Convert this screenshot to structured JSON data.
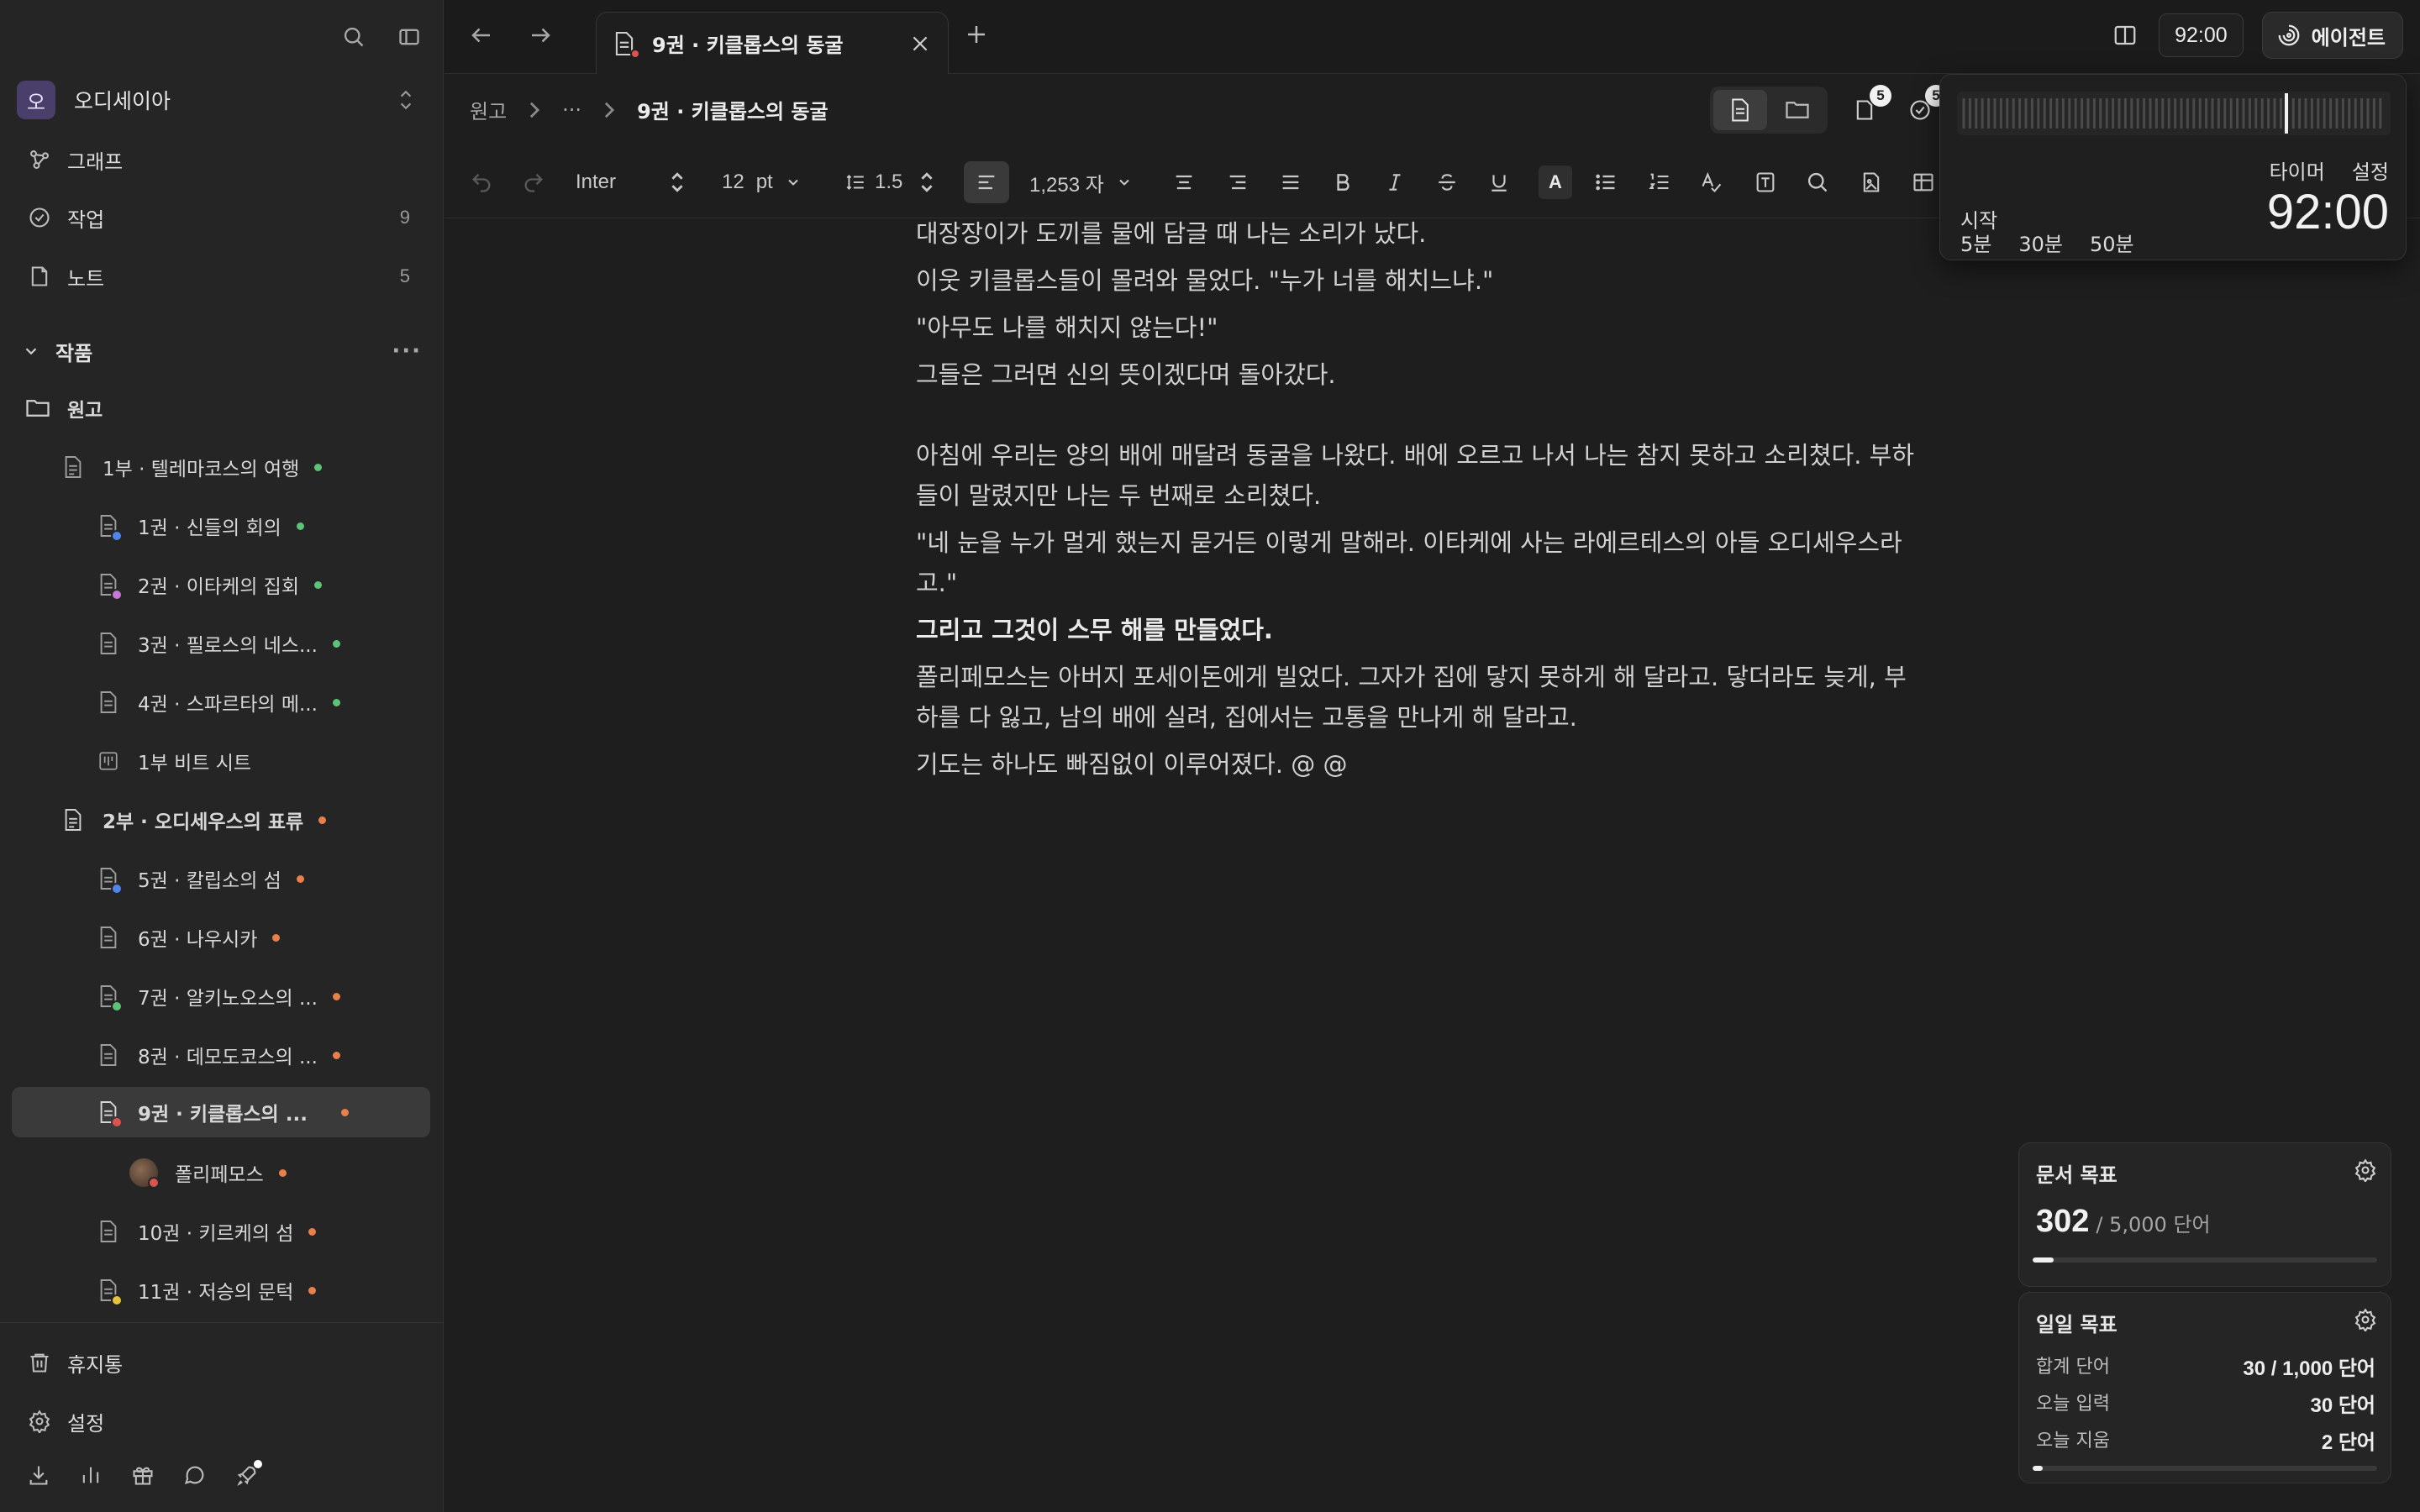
{
  "sidebar": {
    "workspace": {
      "avatar": "오",
      "name": "오디세이아"
    },
    "nav": [
      {
        "label": "그래프",
        "count": ""
      },
      {
        "label": "작업",
        "count": "9"
      },
      {
        "label": "노트",
        "count": "5"
      }
    ],
    "section": {
      "label": "작품",
      "more": "···"
    },
    "tree": [
      {
        "label": "원고"
      },
      {
        "label": "1부 · 텔레마코스의 여행"
      },
      {
        "label": "1권 · 신들의 회의"
      },
      {
        "label": "2권 · 이타케의 집회"
      },
      {
        "label": "3권 · 필로스의 네스..."
      },
      {
        "label": "4권 · 스파르타의 메..."
      },
      {
        "label": "1부 비트 시트"
      },
      {
        "label": "2부 · 오디세우스의 표류"
      },
      {
        "label": "5권 · 칼립소의 섬"
      },
      {
        "label": "6권 · 나우시카"
      },
      {
        "label": "7권 · 알키노오스의 ..."
      },
      {
        "label": "8권 · 데모도코스의 ..."
      },
      {
        "label": "9권 · 키클롭스의 ..."
      },
      {
        "label": "폴리페모스"
      },
      {
        "label": "10권 · 키르케의 섬"
      },
      {
        "label": "11권 · 저승의 문턱"
      }
    ],
    "footer": [
      {
        "label": "휴지통"
      },
      {
        "label": "설정"
      }
    ]
  },
  "tabbar": {
    "tab_title": "9권 · 키클롭스의 동굴",
    "timer": "92:00",
    "agent_label": "에이전트"
  },
  "breadcrumb": {
    "root": "원고",
    "ellipsis": "···",
    "current": "9권 · 키클롭스의 동굴",
    "pages_count": "5",
    "tasks_count": "5"
  },
  "toolbar": {
    "font": "Inter",
    "size": "12",
    "unit": "pt",
    "line_height": "1.5",
    "char_count": "1,253 자",
    "color_label": "A"
  },
  "editor": {
    "paragraphs": [
      "대장장이가 도끼를 물에 담글 때 나는 소리가 났다.",
      "이웃 키클롭스들이 몰려와 물었다. \"누가 너를 해치느냐.\"",
      "\"아무도 나를 해치지 않는다!\"",
      "그들은 그러면 신의 뜻이겠다며 돌아갔다.",
      "아침에 우리는 양의 배에 매달려 동굴을 나왔다. 배에 오르고 나서 나는 참지 못하고 소리쳤다. 부하들이 말렸지만 나는 두 번째로 소리쳤다.",
      "\"네 눈을 누가 멀게 했는지 묻거든 이렇게 말해라. 이타케에 사는 라에르테스의 아들 오디세우스라고.\"",
      "그리고 그것이 스무 해를 만들었다.",
      "폴리페모스는 아버지 포세이돈에게 빌었다. 그자가 집에 닿지 못하게 해 달라고. 닿더라도 늦게, 부하를 다 잃고, 남의 배에 실려, 집에서는 고통을 만나게 해 달라고.",
      "기도는 하나도 빠짐없이 이루어졌다. @ @"
    ]
  },
  "timer_popup": {
    "presets": [
      "5분",
      "30분",
      "50분"
    ],
    "timer_link": "타이머",
    "settings_link": "설정",
    "start_label": "시작",
    "time": "92:00"
  },
  "doc_goal": {
    "title": "문서 목표",
    "current": "302",
    "target": "/ 5,000 단어",
    "progress": 0.06
  },
  "daily_goal": {
    "title": "일일 목표",
    "rows": [
      {
        "label": "합계 단어",
        "value": "30 / 1,000 단어"
      },
      {
        "label": "오늘 입력",
        "value": "30 단어"
      },
      {
        "label": "오늘 지움",
        "value": "2 단어"
      }
    ],
    "progress": 0.03
  },
  "colors": {
    "green": "#5cc476",
    "orange": "#e9804a",
    "blue": "#4f86e8",
    "pink": "#c677d8",
    "red": "#d9534f",
    "yellow": "#e6c33c"
  }
}
